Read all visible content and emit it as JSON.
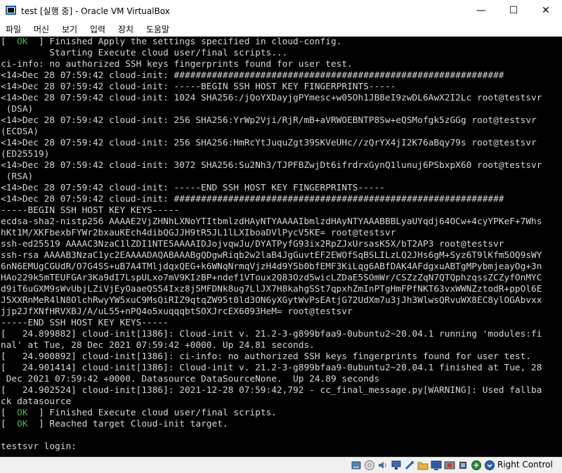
{
  "window": {
    "title": "test [실행 중] - Oracle VM VirtualBox",
    "minimize_glyph": "—",
    "maximize_glyph": "☐",
    "close_glyph": "✕"
  },
  "menu": [
    "파일",
    "머신",
    "보기",
    "입력",
    "장치",
    "도움말"
  ],
  "console": {
    "lines": [
      {
        "prefix": "[  ",
        "ok": "OK",
        "text": "  ] Finished Apply the settings specified in cloud-config."
      },
      {
        "text": "         Starting Execute cloud user/final scripts..."
      },
      {
        "text": "ci-info: no authorized SSH keys fingerprints found for user test."
      },
      {
        "text": "<14>Dec 28 07:59:42 cloud-init: #############################################################"
      },
      {
        "text": "<14>Dec 28 07:59:42 cloud-init: -----BEGIN SSH HOST KEY FINGERPRINTS-----"
      },
      {
        "text": "<14>Dec 28 07:59:42 cloud-init: 1024 SHA256:/jQoYXDayjgPYmesc+w05Oh1JB8eI9zwDL6AwX2I2Lc root@testsvr"
      },
      {
        "text": " (DSA)"
      },
      {
        "text": "<14>Dec 28 07:59:42 cloud-init: 256 SHA256:YrWp2Vji/RjR/mB+aVRWOEBNTP8Sw+eQSMofgk5zGGg root@testsvr"
      },
      {
        "text": "(ECDSA)"
      },
      {
        "text": "<14>Dec 28 07:59:42 cloud-init: 256 SHA256:HmRcYtJuquZgt39SKVeUHc//zQrYX4jI2K76aBqy79s root@testsvr"
      },
      {
        "text": "(ED25519)"
      },
      {
        "text": "<14>Dec 28 07:59:42 cloud-init: 3072 SHA256:Su2Nh3/TJPFBZwjDt6ifrdrxGynQ1lunuj6PSbxpX60 root@testsvr"
      },
      {
        "text": " (RSA)"
      },
      {
        "text": "<14>Dec 28 07:59:42 cloud-init: -----END SSH HOST KEY FINGERPRINTS-----"
      },
      {
        "text": "<14>Dec 28 07:59:42 cloud-init: #############################################################"
      },
      {
        "text": "-----BEGIN SSH HOST KEY KEYS-----"
      },
      {
        "text": "ecdsa-sha2-nistp256 AAAAE2VjZHNhLXNoYTItbmlzdHAyNTYAAAAIbmlzdHAyNTYAAABBBLyaUYqdj64OCw+4cyYPKeF+7Whs"
      },
      {
        "text": "hKt1M/XKFbexbFYWr2bxauKEch4dibQGJJH9tR5JL1lLXIboaDVlPycV5KE= root@testsvr"
      },
      {
        "text": "ssh-ed25519 AAAAC3NzaC1lZDI1NTE5AAAAIDJojvqwJu/DYATPyfG93ix2RpZJxUrsasK5X/bT2AP3 root@testsvr"
      },
      {
        "text": "ssh-rsa AAAAB3NzaC1yc2EAAAADAQABAAABgQDgwRiqb2w2laB4JgGuvtEF2EWOfSqBSLILzLQ2JHs6gM+Syz6T9lKfm5OQ9sWY"
      },
      {
        "text": "6nN6EMUgCGUdR/O7G4SS+uB7A4TMljdqxQEG+k6WNqNrmqVjzH4d9Y5b0bfEMF3KiLqg6ABfDAK4AFdgxuABTgMPybmjeayOg+3n"
      },
      {
        "text": "HAo229k5mTEUFGAr3Ka9dI7LspULxo7mV9KIzBP+ndef1VToux2Q83Ozd5wicLZDaE5SOmWr/CSZzZqN7QTQphzqssZCZyfOnMYC"
      },
      {
        "text": "d9iT6uGXM9sWvUbjLZiVjEyOaaeQS54Ixz8j5MFDNk8ug7LlJX7H8kahgSSt7qpxhZmInPTgHmFPfNKT63vxWWNZztodR+ppOl6E"
      },
      {
        "text": "J5XXRnMeR4lN8OlchRwyYW5xuC9MsQiRIZ9qtqZW95t0ld3ON6yXGytWvPsEAtjG72UdXm7u3jJh3WlwsQRvuWX8EC8ylOGAbvxx"
      },
      {
        "text": "jjp2JfXNfHRVXBJ/A/uL55+nPQ4o5xuqqqbtSOXJrcEX6093HeM= root@testsvr"
      },
      {
        "text": "-----END SSH HOST KEY KEYS-----"
      },
      {
        "text": "[   24.899882] cloud-init[1386]: Cloud-init v. 21.2-3-g899bfaa9-0ubuntu2~20.04.1 running 'modules:fi"
      },
      {
        "text": "nal' at Tue, 28 Dec 2021 07:59:42 +0000. Up 24.81 seconds."
      },
      {
        "text": "[   24.900892] cloud-init[1386]: ci-info: no authorized SSH keys fingerprints found for user test."
      },
      {
        "text": "[   24.901414] cloud-init[1386]: Cloud-init v. 21.2-3-g899bfaa9-0ubuntu2~20.04.1 finished at Tue, 28"
      },
      {
        "text": " Dec 2021 07:59:42 +0000. Datasource DataSourceNone.  Up 24.89 seconds"
      },
      {
        "text": "[   24.902524] cloud-init[1386]: 2021-12-28 07:59:42,792 - cc_final_message.py[WARNING]: Used fallba"
      },
      {
        "text": "ck datasource"
      },
      {
        "prefix": "[  ",
        "ok": "OK",
        "text": "  ] Finished Execute cloud user/final scripts."
      },
      {
        "prefix": "[  ",
        "ok": "OK",
        "text": "  ] Reached target Cloud-init target."
      },
      {
        "text": ""
      },
      {
        "text": "testsvr login: "
      }
    ]
  },
  "statusbar": {
    "icons": [
      "hard-disk-icon",
      "optical-drive-icon",
      "audio-icon",
      "network-icon",
      "usb-icon",
      "shared-folders-icon",
      "display-icon",
      "video-capture-icon",
      "cpu-icon",
      "mouse-integration-icon",
      "arrow-down-icon"
    ],
    "host_key": "Right Control"
  },
  "colors": {
    "ok_green": "#3fbf3f",
    "console_bg": "#000000",
    "console_text": "#d7d7d7"
  }
}
